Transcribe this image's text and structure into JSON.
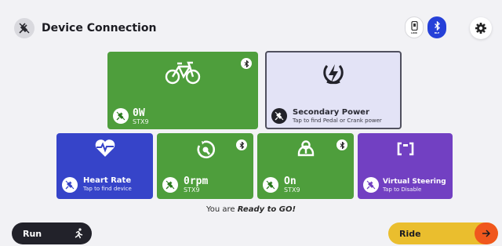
{
  "header": {
    "title": "Device Connection",
    "mode_link_label": "LINK",
    "mode_ble_label": "BLE"
  },
  "tiles": {
    "power": {
      "value": "0W",
      "device": "STX9"
    },
    "secondary_power": {
      "name": "Secondary Power",
      "hint": "Tap to find Pedal or Crank power"
    },
    "heart_rate": {
      "name": "Heart Rate",
      "hint": "Tap to find device"
    },
    "cadence": {
      "value": "0rpm",
      "device": "STX9"
    },
    "steering": {
      "value": "On",
      "device": "STX9"
    },
    "virtual_steering": {
      "name": "Virtual Steering",
      "hint": "Tap to Disable"
    }
  },
  "status": {
    "prefix": "You are ",
    "emphasis": "Ready to GO!"
  },
  "footer": {
    "run_label": "Run",
    "ride_label": "Ride"
  },
  "colors": {
    "green": "#4e9e3c",
    "blue": "#3644c9",
    "purple": "#7240c2",
    "secondary_bg": "#e3e3f6",
    "ride_yellow": "#eabe2e",
    "accent_orange": "#f0571d",
    "ble_blue": "#2540d8"
  },
  "icons": [
    "plug-off-icon",
    "phone-link-icon",
    "bluetooth-icon",
    "gear-icon",
    "bike-icon",
    "lightning-icon",
    "heart-rate-icon",
    "cadence-icon",
    "steering-icon",
    "virtual-steering-icon",
    "runner-icon",
    "arrow-right-icon"
  ]
}
